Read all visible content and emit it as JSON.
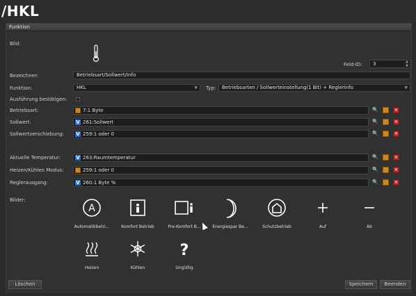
{
  "window": {
    "title": "/HKL"
  },
  "tab": {
    "label": "Funktion"
  },
  "form": {
    "bild_label": "Bild:",
    "feld_id_label": "Feld-ID:",
    "feld_id_value": "3",
    "bezeichner_label": "Bezeichner:",
    "bezeichner_value": "Betriebsart/Sollwert/Info",
    "funktion_label": "Funktion:",
    "funktion_value": "HKL",
    "typ_label": "Typ:",
    "typ_value": "Betriebsarten / Sollwerteinstellung(1 Bit) + Reglerinfo",
    "ausfuehrung_label": "Ausführung bestätigen:",
    "ausfuehrung_checked": false
  },
  "objects": [
    {
      "label": "Betriebsart:",
      "value": "7:1 Byte",
      "badge": "box-icon"
    },
    {
      "label": "Sollwert:",
      "value": "261:Sollwert",
      "badge": "v-icon"
    },
    {
      "label": "Sollwertverschiebung:",
      "value": "259:1 oder 0",
      "badge": "v-icon"
    },
    {
      "label": "Aktuelle Temperatur:",
      "value": "263:Raumtemperatur",
      "badge": "v-icon"
    },
    {
      "label": "Heizen/Kühlen Modus:",
      "value": "259:1 oder 0",
      "badge": "box-icon"
    },
    {
      "label": "Reglerausgang:",
      "value": "260:1 Byte %",
      "badge": "v-icon"
    }
  ],
  "bilder": {
    "label": "Bilder:",
    "items": [
      {
        "caption": "Automatikbetri...",
        "icon": "automatic-icon"
      },
      {
        "caption": "Komfort Betrieb",
        "icon": "comfort-icon"
      },
      {
        "caption": "Pre-Komfort B...",
        "icon": "pre-comfort-icon"
      },
      {
        "caption": "Energiespar Be...",
        "icon": "moon-icon"
      },
      {
        "caption": "Schutzbetrieb",
        "icon": "house-icon"
      },
      {
        "caption": "Auf",
        "icon": "plus-icon"
      },
      {
        "caption": "Ab",
        "icon": "minus-icon"
      },
      {
        "caption": "Heizen",
        "icon": "heat-icon"
      },
      {
        "caption": "Kühlen",
        "icon": "snowflake-icon"
      },
      {
        "caption": "Ungültig",
        "icon": "question-icon"
      }
    ]
  },
  "buttons": {
    "delete": "Löschen",
    "save": "Speichern",
    "close": "Beenden"
  },
  "colors": {
    "accent_blue": "#2a6fc9",
    "delete_red": "#b52a2a",
    "box_orange": "#c9892b"
  }
}
